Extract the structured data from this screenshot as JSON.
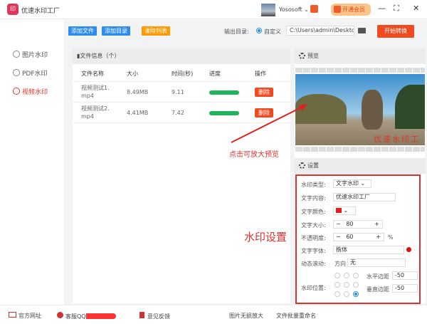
{
  "app": {
    "title": "优速水印工厂",
    "logo_text": "印",
    "user": "Yososoft ⌄",
    "vip": "开通会员"
  },
  "window": {
    "minimize": "—",
    "maximize": "⛶",
    "close": "✕"
  },
  "sidebar": {
    "items": [
      {
        "label": "图片水印"
      },
      {
        "label": "PDF水印"
      },
      {
        "label": "视频水印",
        "active": true
      }
    ]
  },
  "toolbar": {
    "add_file": "添加文件",
    "add_dir": "添加目录",
    "clear": "清除列表",
    "output_label": "输出目录:",
    "custom": "自定义",
    "path": "C:\\Users\\admin\\Deskto",
    "start": "开始转换"
  },
  "files": {
    "header": "文件信息（个）",
    "columns": [
      "文件名称",
      "大小",
      "时间(秒)",
      "进度",
      "操作"
    ],
    "rows": [
      {
        "name1": "视频测试1.",
        "name2": "mp4",
        "size": "8.49MB",
        "time": "9.11",
        "progress": 100,
        "action": "删除"
      },
      {
        "name1": "视频测试2.",
        "name2": "mp4",
        "size": "4.41MB",
        "time": "7.42",
        "progress": 100,
        "action": "删除"
      }
    ]
  },
  "preview": {
    "title": "预览",
    "watermark": "优速水印工厂"
  },
  "settings": {
    "title": "设置",
    "type_label": "水印类型:",
    "type": "文字水印 ⌄",
    "content_label": "文字内容:",
    "content": "优速水印工厂",
    "color_label": "文字颜色:",
    "color": "#e81c1c",
    "size_label": "文字大小:",
    "size": "80",
    "opacity_label": "不透明度:",
    "opacity": "60",
    "pct": "%",
    "font_label": "文字字体:",
    "font": "楷体",
    "scroll_label": "动态滚动:",
    "dir_label": "方向",
    "dir": "无",
    "pos_label": "水印位置:",
    "h_label": "水平边距",
    "h": "-50",
    "v_label": "垂直边距",
    "v": "-50",
    "minus": "−",
    "plus": "+",
    "caret": "⌄"
  },
  "annotations": {
    "preview_hint": "点击可放大预览",
    "settings_hint": "水印设置"
  },
  "footer": {
    "site": "官方网址",
    "qq": "客服QQ",
    "feedback": "意见反馈",
    "enlarge": "图片无损放大",
    "rename": "文件批量重命名"
  }
}
